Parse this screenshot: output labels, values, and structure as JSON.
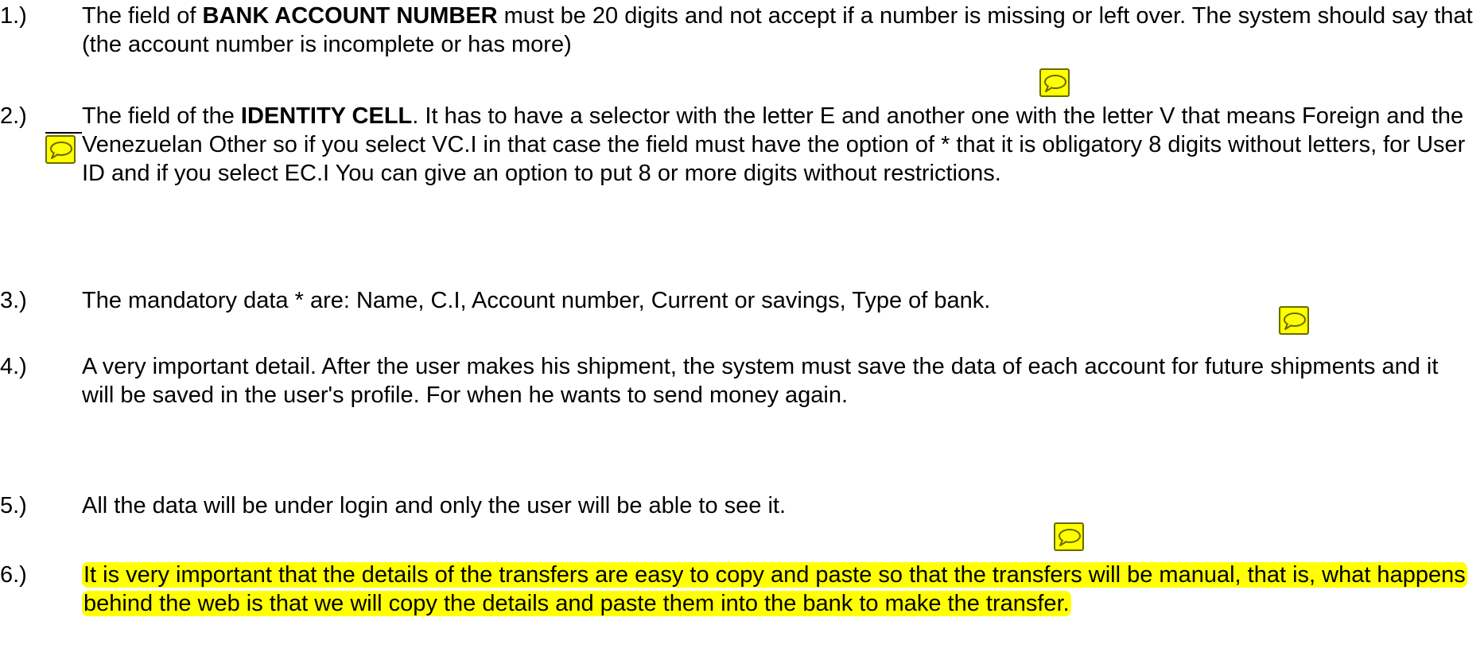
{
  "items": [
    {
      "number": "1.)",
      "parts": [
        {
          "text": "The field of ",
          "bold": false
        },
        {
          "text": "BANK ACCOUNT NUMBER",
          "bold": true
        },
        {
          "text": " must be 20 digits and not accept if a number is missing or left over. The system should say that (the account number is incomplete or has more)",
          "bold": false
        }
      ]
    },
    {
      "number": "2.)",
      "parts": [
        {
          "text": "The field of the ",
          "bold": false
        },
        {
          "text": "IDENTITY CELL",
          "bold": true
        },
        {
          "text": ". It has to have a selector with the letter E and another one with the letter V that means Foreign and the Venezuelan Other so if you select VC.I in that case the field must have the option of * that it is obligatory 8 digits without letters, for User ID and if you select EC.I You can give an option to put 8 or more digits without restrictions.",
          "bold": false
        }
      ]
    },
    {
      "number": "3.)",
      "parts": [
        {
          "text": "The mandatory data * are: Name, C.I, Account number, Current or savings, Type of bank.",
          "bold": false
        }
      ]
    },
    {
      "number": "4.)",
      "parts": [
        {
          "text": "A very important detail. After the user makes his shipment, the system must save the data of each account for future shipments and it will be saved in the user's profile. For when he wants to send money again.",
          "bold": false
        }
      ]
    },
    {
      "number": "5.)",
      "parts": [
        {
          "text": " All the data will be under login and only the user will be able to see it.",
          "bold": false
        }
      ]
    },
    {
      "number": "6.)",
      "highlight": true,
      "parts": [
        {
          "text": "It is very important that the details of the transfers are easy to copy and paste so that the transfers will be manual, that is, what happens behind the web is that we will copy the details and paste them into the bank to make the transfer.",
          "bold": false
        }
      ]
    }
  ],
  "comment_icons": [
    {
      "name": "comment-1",
      "icon": "speech-bubble-icon"
    },
    {
      "name": "comment-2",
      "icon": "speech-bubble-icon"
    },
    {
      "name": "comment-3",
      "icon": "speech-bubble-icon"
    },
    {
      "name": "comment-4",
      "icon": "speech-bubble-icon"
    }
  ],
  "colors": {
    "highlight": "#ffff00",
    "comment_fill": "#ffff00",
    "text": "#000000"
  }
}
